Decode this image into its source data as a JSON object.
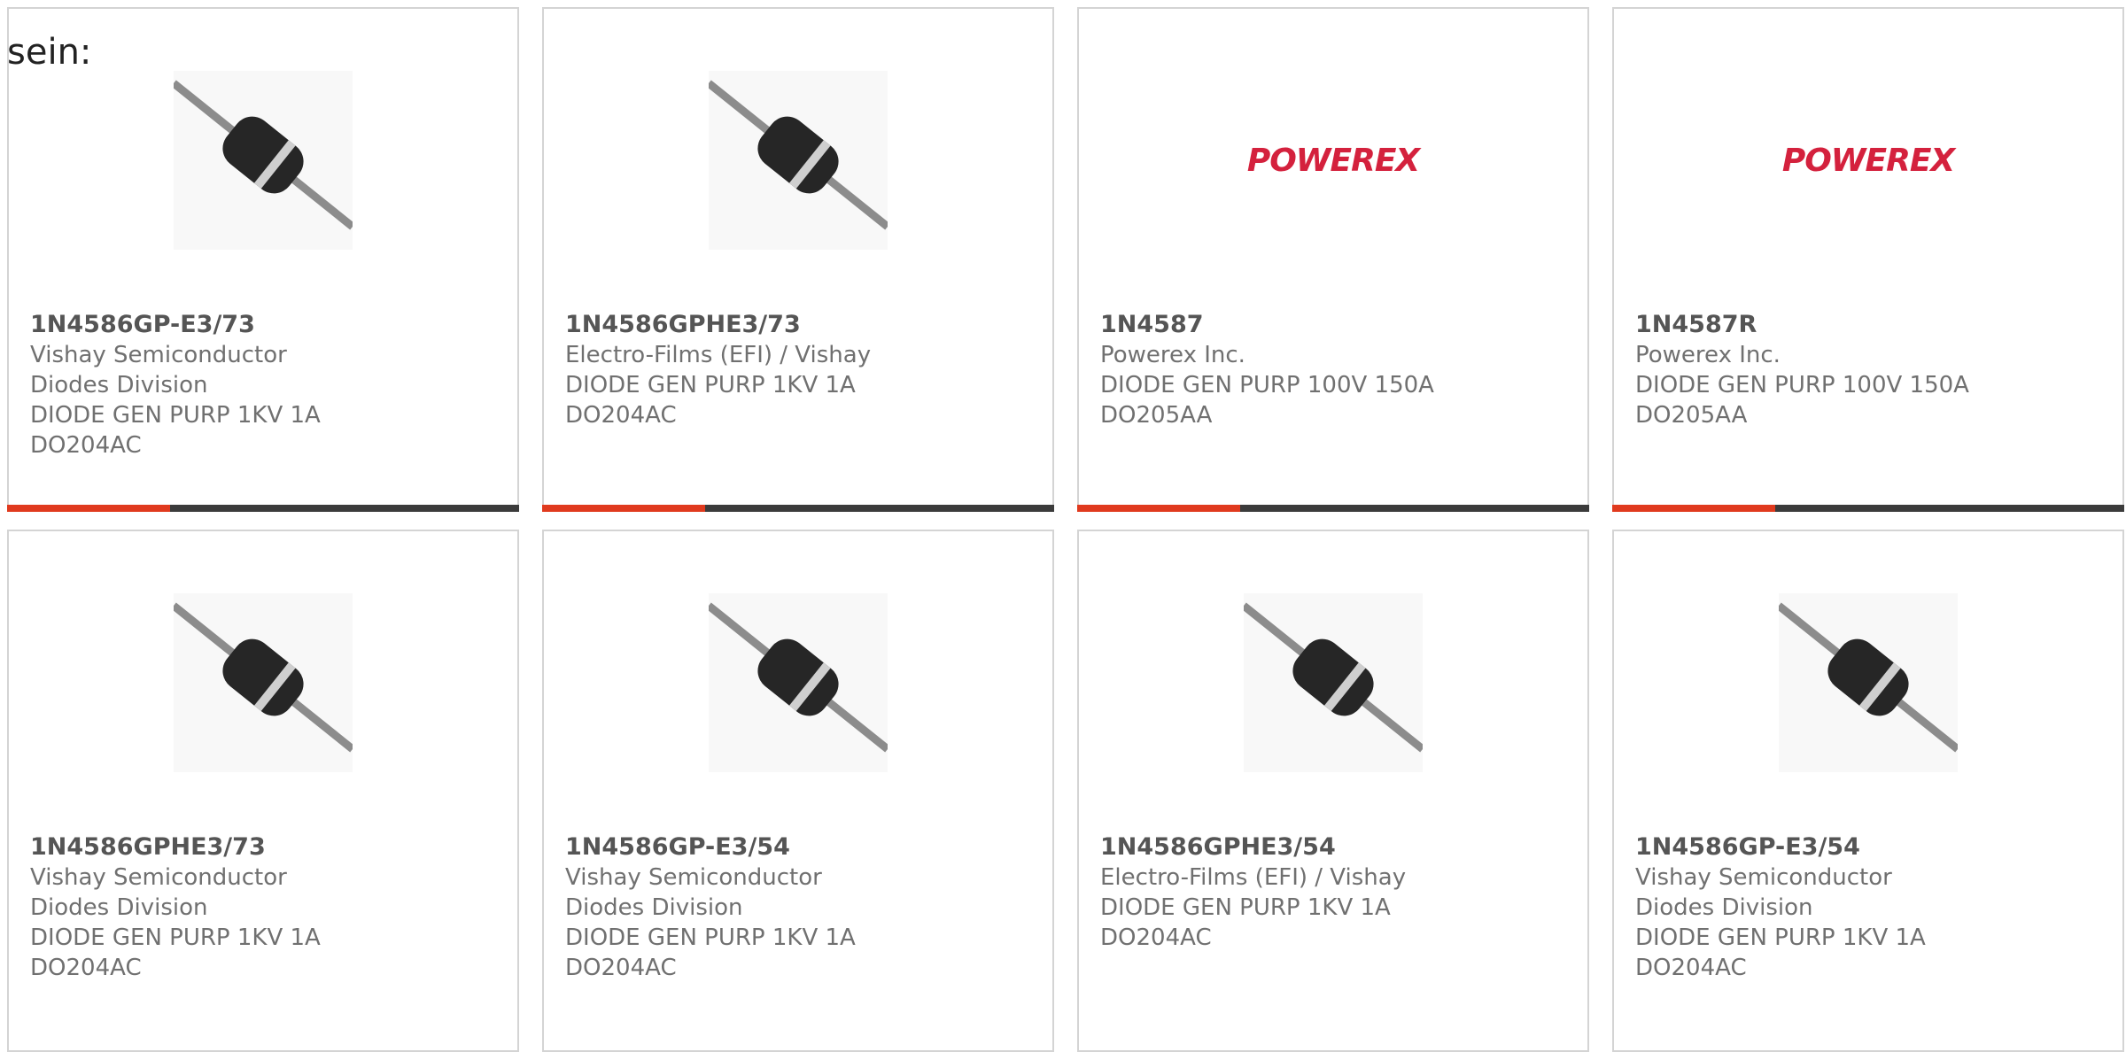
{
  "intro_text": "sein:",
  "colors": {
    "accent": "#e03a1e",
    "bar": "#3b3b3b",
    "brand_powerex": "#d4213d"
  },
  "products": [
    {
      "part_number": "1N4586GP-E3/73",
      "manufacturer": "Vishay Semiconductor Diodes Division",
      "description": "DIODE GEN PURP 1KV 1A DO204AC",
      "image": "diode-image"
    },
    {
      "part_number": "1N4586GPHE3/73",
      "manufacturer": "Electro-Films (EFI) / Vishay",
      "description": "DIODE GEN PURP 1KV 1A DO204AC",
      "image": "diode-image"
    },
    {
      "part_number": "1N4587",
      "manufacturer": "Powerex Inc.",
      "description": "DIODE GEN PURP 100V 150A DO205AA",
      "image": "powerex-logo",
      "logo_text": "POWEREX"
    },
    {
      "part_number": "1N4587R",
      "manufacturer": "Powerex Inc.",
      "description": "DIODE GEN PURP 100V 150A DO205AA",
      "image": "powerex-logo",
      "logo_text": "POWEREX"
    },
    {
      "part_number": "1N4586GPHE3/73",
      "manufacturer": "Vishay Semiconductor Diodes Division",
      "description": "DIODE GEN PURP 1KV 1A DO204AC",
      "image": "diode-image"
    },
    {
      "part_number": "1N4586GP-E3/54",
      "manufacturer": "Vishay Semiconductor Diodes Division",
      "description": "DIODE GEN PURP 1KV 1A DO204AC",
      "image": "diode-image"
    },
    {
      "part_number": "1N4586GPHE3/54",
      "manufacturer": "Electro-Films (EFI) / Vishay",
      "description": "DIODE GEN PURP 1KV 1A DO204AC",
      "image": "diode-image"
    },
    {
      "part_number": "1N4586GP-E3/54",
      "manufacturer": "Vishay Semiconductor Diodes Division",
      "description": "DIODE GEN PURP 1KV 1A DO204AC",
      "image": "diode-image"
    }
  ]
}
